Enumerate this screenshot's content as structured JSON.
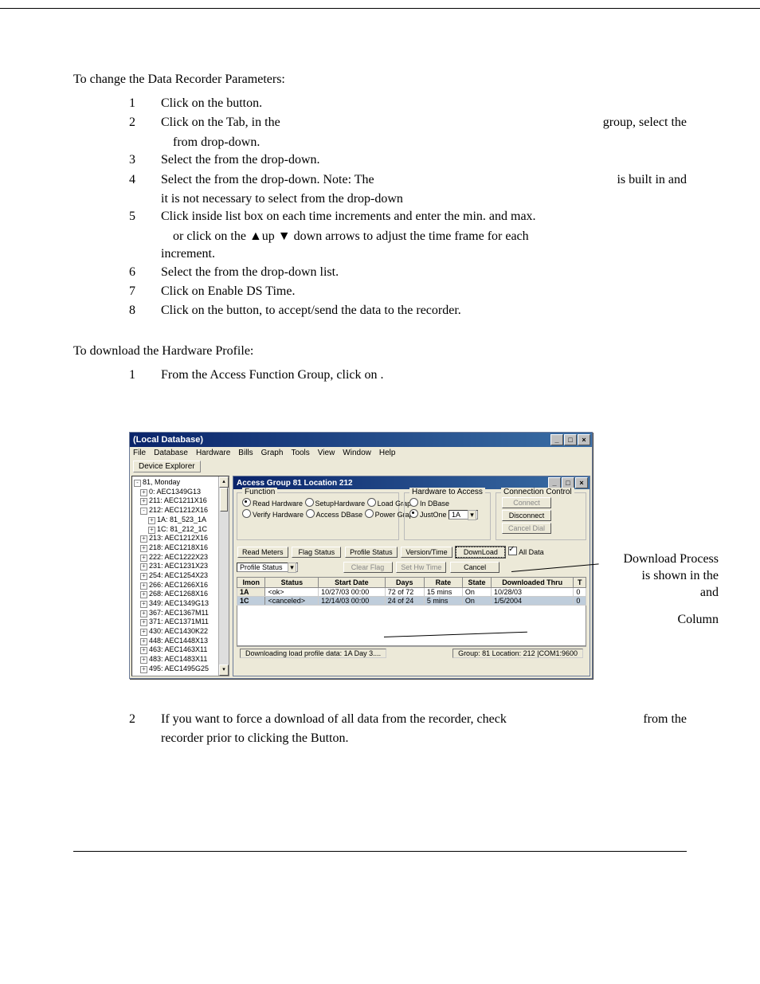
{
  "intro1": "To change the Data Recorder Parameters:",
  "steps1": {
    "1": "Click on the                               button.",
    "2a": "Click on the                        Tab, in the",
    "2b_right": "group, select the",
    "2c": "from drop-down.",
    "3": "Select the                               from the drop-down.",
    "4a": "Select the                                    from the drop-down. Note: The",
    "4b_right": "is built in and",
    "4c": "it is not necessary to select from the drop-down",
    "5a": "Click inside list box on each time increments and enter the min. and max.",
    "5b": "or click on the ▲up ▼ down arrows to adjust the time frame for each",
    "5c": "increment.",
    "6": "Select the                        from the drop-down list.",
    "7": "Click on Enable DS Time.",
    "8": "Click on the                                    button, to accept/send the data to the recorder."
  },
  "intro2": "To download the Hardware Profile:",
  "steps2": {
    "1": "From the Access Function Group, click on                              ."
  },
  "intro3_num": "2",
  "intro3a": "If you want to force a download of all data from the recorder, check",
  "intro3a_r": "from the",
  "intro3b": "recorder prior to clicking the                     Button.",
  "app": {
    "title": "(Local Database)",
    "menu": [
      "File",
      "Database",
      "Hardware",
      "Bills",
      "Graph",
      "Tools",
      "View",
      "Window",
      "Help"
    ],
    "toolbar_btn": "Device Explorer",
    "tree": [
      {
        "lvl": 0,
        "box": "-",
        "t": "81, Monday"
      },
      {
        "lvl": 1,
        "box": "+",
        "t": "0: AEC1349G13"
      },
      {
        "lvl": 1,
        "box": "+",
        "t": "211: AEC1211X16"
      },
      {
        "lvl": 1,
        "box": "-",
        "t": "212: AEC1212X16"
      },
      {
        "lvl": 2,
        "box": "+",
        "t": "1A: 81_523_1A"
      },
      {
        "lvl": 2,
        "box": "+",
        "t": "1C: 81_212_1C"
      },
      {
        "lvl": 1,
        "box": "+",
        "t": "213: AEC1212X16"
      },
      {
        "lvl": 1,
        "box": "+",
        "t": "218: AEC1218X16"
      },
      {
        "lvl": 1,
        "box": "+",
        "t": "222: AEC1222X23"
      },
      {
        "lvl": 1,
        "box": "+",
        "t": "231: AEC1231X23"
      },
      {
        "lvl": 1,
        "box": "+",
        "t": "254: AEC1254X23"
      },
      {
        "lvl": 1,
        "box": "+",
        "t": "266: AEC1266X16"
      },
      {
        "lvl": 1,
        "box": "+",
        "t": "268: AEC1268X16"
      },
      {
        "lvl": 1,
        "box": "+",
        "t": "349: AEC1349G13"
      },
      {
        "lvl": 1,
        "box": "+",
        "t": "367: AEC1367M11"
      },
      {
        "lvl": 1,
        "box": "+",
        "t": "371: AEC1371M11"
      },
      {
        "lvl": 1,
        "box": "+",
        "t": "430: AEC1430K22"
      },
      {
        "lvl": 1,
        "box": "+",
        "t": "448: AEC1448X13"
      },
      {
        "lvl": 1,
        "box": "+",
        "t": "463: AEC1463X11"
      },
      {
        "lvl": 1,
        "box": "+",
        "t": "483: AEC1483X11"
      },
      {
        "lvl": 1,
        "box": "+",
        "t": "495: AEC1495G25"
      }
    ],
    "child_title": "Access Group 81 Location 212",
    "function": {
      "legend": "Function",
      "r1a": "Read Hardware",
      "r1b": "SetupHardware",
      "r1c": "Load Graph",
      "r2a": "Verify Hardware",
      "r2b": "Access DBase",
      "r2c": "Power Graph"
    },
    "hw_access": {
      "legend": "Hardware to Access",
      "opt1": "In DBase",
      "opt2": "JustOne",
      "sel": "1A"
    },
    "conn": {
      "legend": "Connection Control",
      "connect": "Connect",
      "disconnect": "Disconnect",
      "cancel": "Cancel Dial"
    },
    "btnrow": {
      "read": "Read Meters",
      "flag": "Flag Status",
      "profile": "Profile Status",
      "version": "Version/Time",
      "download": "DownLoad",
      "alldata": "All Data",
      "clear": "Clear Flag",
      "set": "Set Hw Time",
      "cancel": "Cancel",
      "ps_label": "Profile Status"
    },
    "table": {
      "cols": [
        "Imon",
        "Status",
        "Start Date",
        "Days",
        "Rate",
        "State",
        "Downloaded Thru",
        "T"
      ],
      "rows": [
        {
          "imon": "1A",
          "status": "<ok>",
          "start": "10/27/03 00:00",
          "days": "72 of 72",
          "rate": "15 mins",
          "state": "On",
          "dl": "10/28/03",
          "t": "0"
        },
        {
          "imon": "1C",
          "status": "<canceled>",
          "start": "12/14/03 00:00",
          "days": "24 of 24",
          "rate": "5 mins",
          "state": "On",
          "dl": "1/5/2004",
          "t": "0"
        }
      ]
    },
    "statusbar": {
      "left": "Downloading load profile data: 1A Day 3....",
      "right": "Group: 81 Location: 212 |COM1:9600"
    }
  },
  "callout": {
    "l1": "Download Process",
    "l2": "is shown in the",
    "l3a": "and",
    "l4": "Column"
  }
}
